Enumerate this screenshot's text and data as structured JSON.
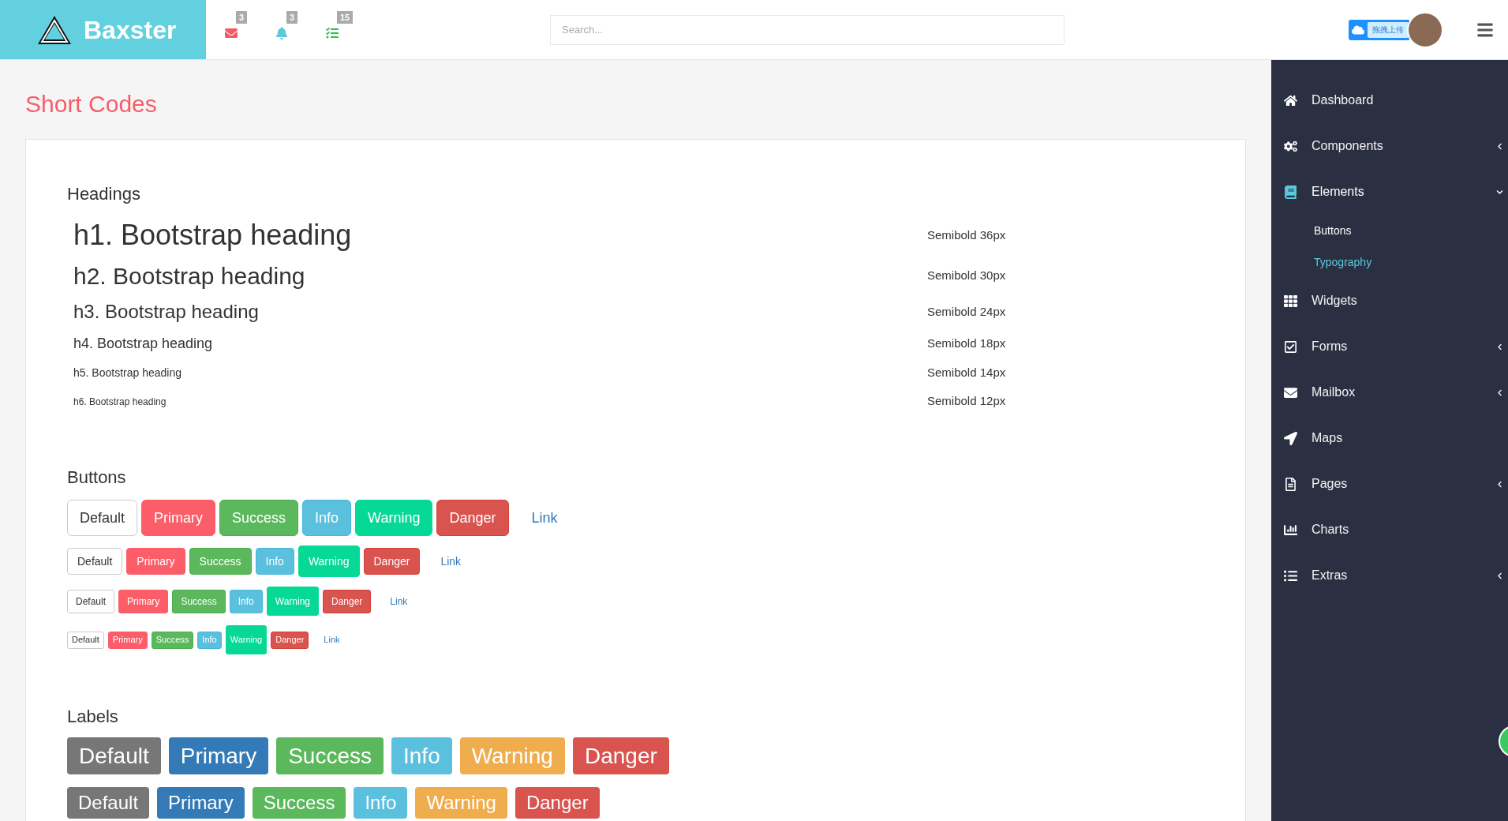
{
  "header": {
    "logo": "Baxster",
    "notifications": [
      {
        "kind": "mail",
        "count": "3"
      },
      {
        "kind": "bell",
        "count": "3"
      },
      {
        "kind": "list",
        "count": "15"
      }
    ],
    "search": {
      "placeholder": "Search..."
    },
    "upload_widget": "拖拽上传"
  },
  "page_title": "Short Codes",
  "headings": {
    "title": "Headings",
    "items": [
      {
        "kind": "h1",
        "text": "h1. Bootstrap heading",
        "note": "Semibold 36px"
      },
      {
        "kind": "h2",
        "text": "h2. Bootstrap heading",
        "note": "Semibold 30px"
      },
      {
        "kind": "h3",
        "text": "h3. Bootstrap heading",
        "note": "Semibold 24px"
      },
      {
        "kind": "h4",
        "text": "h4. Bootstrap heading",
        "note": "Semibold 18px"
      },
      {
        "kind": "h5",
        "text": "h5. Bootstrap heading",
        "note": "Semibold 14px"
      },
      {
        "kind": "h6",
        "text": "h6. Bootstrap heading",
        "note": "Semibold 12px"
      }
    ]
  },
  "buttons": {
    "title": "Buttons",
    "rows": [
      {
        "items": [
          {
            "kind": "default",
            "label": "Default"
          },
          {
            "kind": "primary",
            "label": "Primary"
          },
          {
            "kind": "success",
            "label": "Success"
          },
          {
            "kind": "info",
            "label": "Info"
          },
          {
            "kind": "warning",
            "label": "Warning"
          },
          {
            "kind": "danger",
            "label": "Danger"
          },
          {
            "kind": "link",
            "label": "Link"
          }
        ]
      },
      {
        "items": [
          {
            "kind": "default",
            "label": "Default"
          },
          {
            "kind": "primary",
            "label": "Primary"
          },
          {
            "kind": "success",
            "label": "Success"
          },
          {
            "kind": "info",
            "label": "Info"
          },
          {
            "kind": "warning",
            "label": "Warning"
          },
          {
            "kind": "danger",
            "label": "Danger"
          },
          {
            "kind": "link",
            "label": "Link"
          }
        ]
      },
      {
        "items": [
          {
            "kind": "default",
            "label": "Default"
          },
          {
            "kind": "primary",
            "label": "Primary"
          },
          {
            "kind": "success",
            "label": "Success"
          },
          {
            "kind": "info",
            "label": "Info"
          },
          {
            "kind": "warning",
            "label": "Warning"
          },
          {
            "kind": "danger",
            "label": "Danger"
          },
          {
            "kind": "link",
            "label": "Link"
          }
        ]
      },
      {
        "items": [
          {
            "kind": "default",
            "label": "Default"
          },
          {
            "kind": "primary",
            "label": "Primary"
          },
          {
            "kind": "success",
            "label": "Success"
          },
          {
            "kind": "info",
            "label": "Info"
          },
          {
            "kind": "warning",
            "label": "Warning"
          },
          {
            "kind": "danger",
            "label": "Danger"
          },
          {
            "kind": "link",
            "label": "Link"
          }
        ]
      }
    ]
  },
  "labels": {
    "title": "Labels",
    "rows": [
      {
        "items": [
          {
            "kind": "default",
            "label": "Default"
          },
          {
            "kind": "primary",
            "label": "Primary"
          },
          {
            "kind": "success",
            "label": "Success"
          },
          {
            "kind": "info",
            "label": "Info"
          },
          {
            "kind": "warning",
            "label": "Warning"
          },
          {
            "kind": "danger",
            "label": "Danger"
          }
        ]
      },
      {
        "items": [
          {
            "kind": "default",
            "label": "Default"
          },
          {
            "kind": "primary",
            "label": "Primary"
          },
          {
            "kind": "success",
            "label": "Success"
          },
          {
            "kind": "info",
            "label": "Info"
          },
          {
            "kind": "warning",
            "label": "Warning"
          },
          {
            "kind": "danger",
            "label": "Danger"
          }
        ]
      }
    ]
  },
  "sidebar": {
    "items": [
      {
        "kind": "link",
        "label": "Dashboard",
        "selected": false
      },
      {
        "kind": "group",
        "label": "Components",
        "expanded": false,
        "selected": false
      },
      {
        "kind": "group",
        "label": "Elements",
        "expanded": true,
        "selected": true,
        "children": [
          {
            "label": "Buttons",
            "selected": false
          },
          {
            "label": "Typography",
            "selected": true
          }
        ]
      },
      {
        "kind": "link",
        "label": "Widgets",
        "selected": false
      },
      {
        "kind": "group",
        "label": "Forms",
        "expanded": false,
        "selected": false
      },
      {
        "kind": "group",
        "label": "Mailbox",
        "expanded": false,
        "selected": false
      },
      {
        "kind": "link",
        "label": "Maps",
        "selected": false
      },
      {
        "kind": "group",
        "label": "Pages",
        "expanded": false,
        "selected": false
      },
      {
        "kind": "link",
        "label": "Charts",
        "selected": false
      },
      {
        "kind": "group",
        "label": "Extras",
        "expanded": false,
        "selected": false
      }
    ]
  }
}
